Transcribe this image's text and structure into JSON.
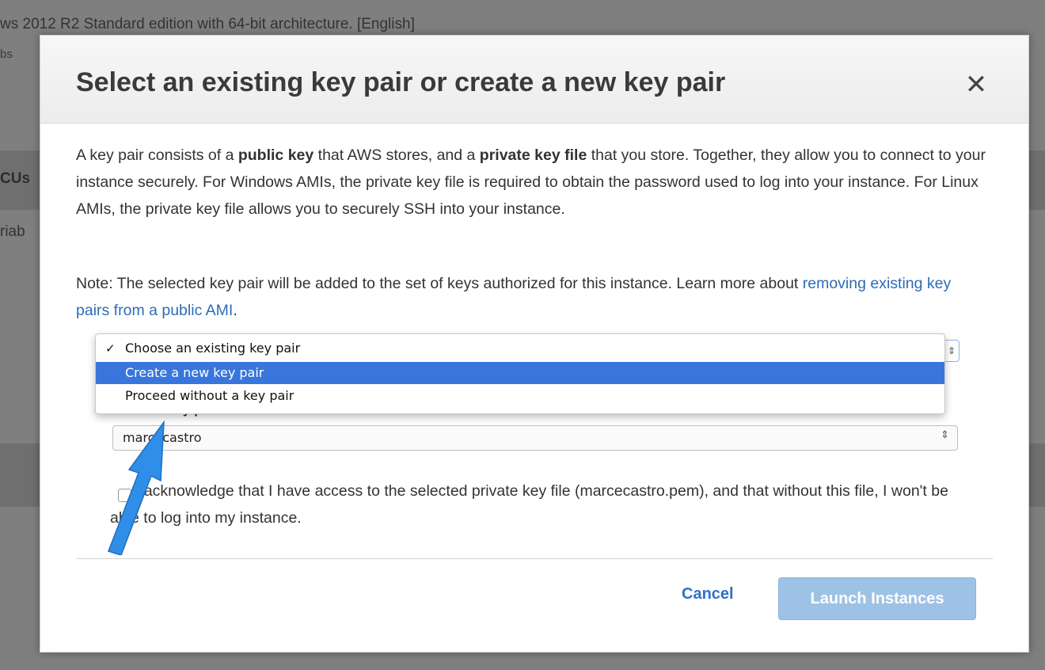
{
  "background": {
    "header_line": "ws 2012 R2 Standard edition with 64-bit architecture. [English]",
    "sub_line": "bs",
    "col_cus": "CUs",
    "col_riab": "riab"
  },
  "modal": {
    "title": "Select an existing key pair or create a new key pair",
    "close_glyph": "✕",
    "para1": {
      "t1": "A key pair consists of a ",
      "b1": "public key",
      "t2": " that AWS stores, and a ",
      "b2": "private key file",
      "t3": " that you store. Together, they allow you to connect to your instance securely. For Windows AMIs, the private key file is required to obtain the password used to log into your instance. For Linux AMIs, the private key file allows you to securely SSH into your instance."
    },
    "para2": {
      "t1": "Note: The selected key pair will be added to the set of keys authorized for this instance. Learn more about ",
      "link": "removing existing key pairs from a public AMI",
      "t2": "."
    },
    "key_pair_dropdown": {
      "options": [
        {
          "label": "Choose an existing key pair",
          "checked": true,
          "highlighted": false
        },
        {
          "label": "Create a new key pair",
          "checked": false,
          "highlighted": true
        },
        {
          "label": "Proceed without a key pair",
          "checked": false,
          "highlighted": false
        }
      ],
      "check_glyph": "✓",
      "arrow_glyph": "⇕"
    },
    "select_key_pair_label": "Select a key pair",
    "key_name_select": {
      "value": "marcecastro",
      "arrow_glyph": "⇕"
    },
    "acknowledge_text": "I acknowledge that I have access to the selected private key file (marcecastro.pem), and that without this file, I won't be able to log into my instance.",
    "cancel_label": "Cancel",
    "launch_label": "Launch Instances"
  },
  "colors": {
    "accent_link": "#2d6cb6",
    "highlight": "#3876db",
    "launch_disabled": "#9ec2e6",
    "annotation_arrow": "#2f8ee8"
  }
}
